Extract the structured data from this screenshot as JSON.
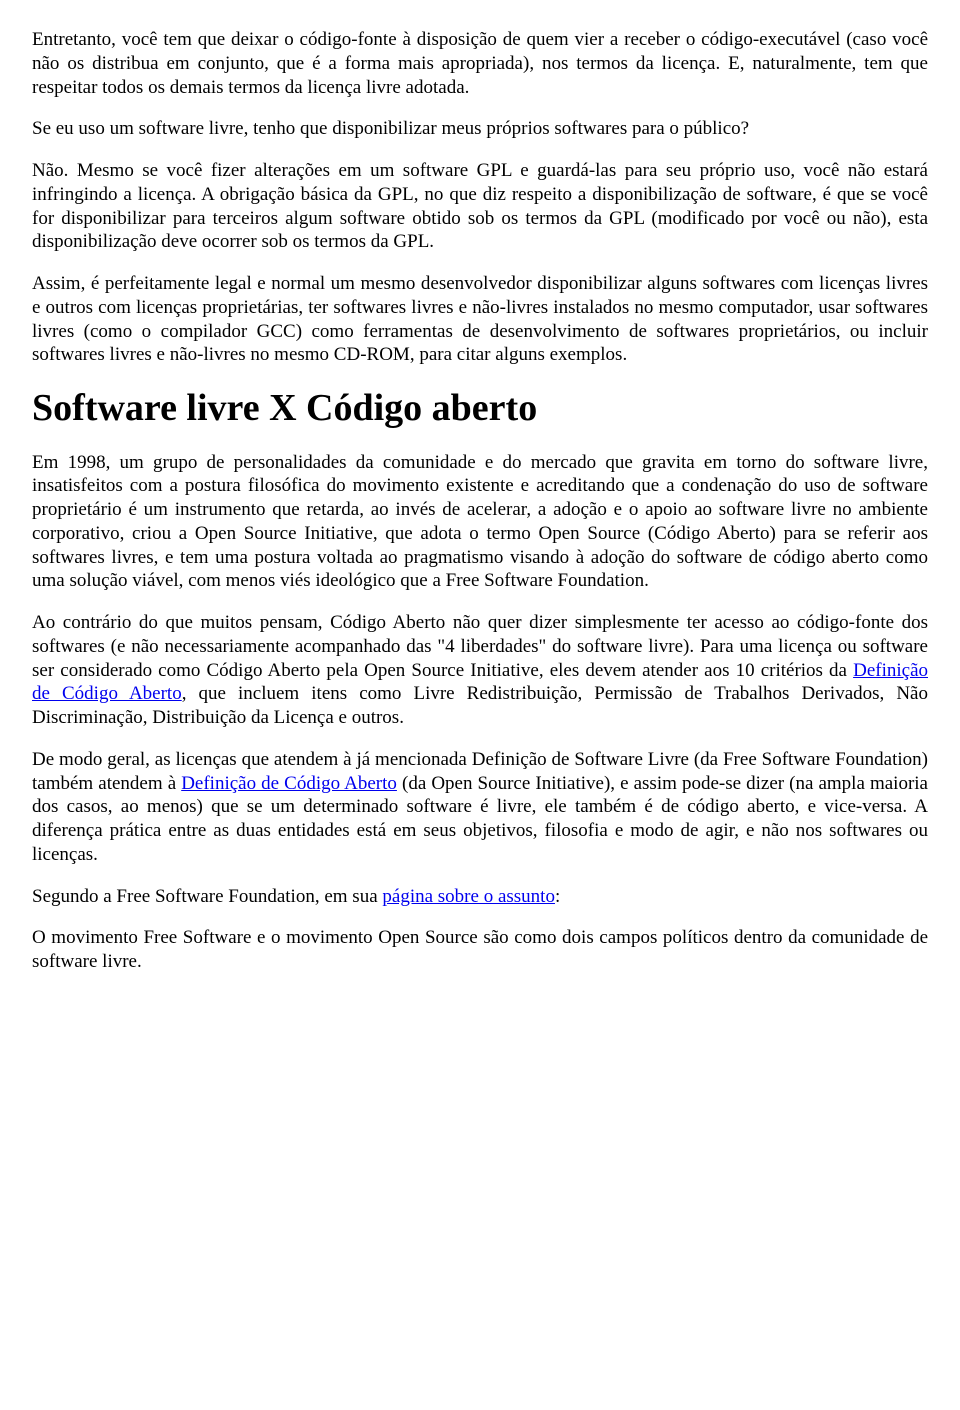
{
  "paragraphs": {
    "p1": "Entretanto, você tem que deixar o código-fonte à disposição de quem vier a receber o código-executável (caso você não os distribua em conjunto, que é a forma mais apropriada), nos termos da licença. E, naturalmente, tem que respeitar todos os demais termos da licença livre adotada.",
    "p2": "Se eu uso um software livre, tenho que disponibilizar meus próprios softwares para o público?",
    "p3": "Não. Mesmo se você fizer alterações em um software GPL e guardá-las para seu próprio uso, você não estará infringindo a licença. A obrigação básica da GPL, no que diz respeito a disponibilização de software, é que se você for disponibilizar para terceiros algum software obtido sob os termos da GPL (modificado por você ou não), esta disponibilização deve ocorrer sob os termos da GPL.",
    "p4": "Assim, é perfeitamente legal e normal um mesmo desenvolvedor disponibilizar alguns softwares com licenças livres e outros com licenças proprietárias, ter softwares livres e não-livres instalados no mesmo computador, usar softwares livres (como o compilador GCC) como ferramentas de desenvolvimento de softwares proprietários, ou incluir softwares livres e não-livres no mesmo CD-ROM, para citar alguns exemplos."
  },
  "heading": "Software livre X Código aberto",
  "section2": {
    "p5": "Em 1998, um grupo de personalidades da comunidade e do mercado que gravita em torno do software livre, insatisfeitos com a postura filosófica do movimento existente e acreditando que a condenação do uso de software proprietário é um instrumento que retarda, ao invés de acelerar, a adoção e o apoio ao software livre no ambiente corporativo, criou a Open Source Initiative, que adota o termo Open Source (Código Aberto) para se referir aos softwares livres, e tem uma postura voltada ao pragmatismo visando à adoção do software de código aberto como uma solução viável, com menos viés ideológico que a Free Software Foundation.",
    "p6_a": "Ao contrário do que muitos pensam, Código Aberto não quer dizer simplesmente ter acesso ao código-fonte dos softwares (e não necessariamente acompanhado das \"4 liberdades\" do software livre). Para uma licença ou software ser considerado como Código Aberto pela Open Source Initiative, eles devem atender aos 10 critérios da ",
    "p6_link": "Definição de Código Aberto",
    "p6_b": ", que incluem itens como Livre Redistribuição, Permissão de Trabalhos Derivados, Não Discriminação, Distribuição da Licença e outros.",
    "p7_a": "De modo geral, as licenças que atendem à já mencionada Definição de Software Livre (da Free Software Foundation) também atendem à ",
    "p7_link": "Definição de Código Aberto",
    "p7_b": " (da Open Source Initiative), e assim pode-se dizer (na ampla maioria dos casos, ao menos) que se um determinado software é livre, ele também é de código aberto, e vice-versa. A diferença prática entre as duas entidades está em seus objetivos, filosofia e modo de agir, e não nos softwares ou licenças.",
    "p8_a": "Segundo a Free Software Foundation, em sua ",
    "p8_link": "página sobre o assunto",
    "p8_b": ":",
    "p9": "O movimento Free Software e o movimento Open Source são como dois campos políticos dentro da comunidade de software livre."
  }
}
